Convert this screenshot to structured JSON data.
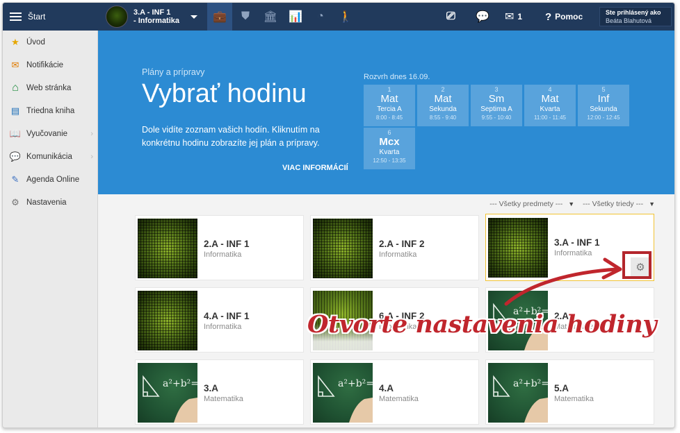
{
  "topbar": {
    "start_label": "Štart",
    "class_selector": {
      "line1": "3.A - INF 1",
      "line2": "- Informatika"
    },
    "module_tabs": [
      {
        "icon": "briefcase-icon",
        "glyph": "💼"
      },
      {
        "icon": "shield-icon",
        "glyph": "⛊"
      },
      {
        "icon": "school-building-icon",
        "glyph": "🏛"
      },
      {
        "icon": "bar-chart-icon",
        "glyph": "📊"
      },
      {
        "icon": "clock-icon",
        "glyph": "◔"
      },
      {
        "icon": "people-walking-icon",
        "glyph": "🚶"
      }
    ],
    "present_icon": "⎚",
    "chat_icon": "💬",
    "mail_icon": "✉",
    "mail_count": "1",
    "help_label": "Pomoc",
    "help_icon": "?",
    "login": {
      "line1": "Ste prihlásený ako",
      "line2": "Beáta Blahutová"
    }
  },
  "sidebar": {
    "items": [
      {
        "label": "Úvod",
        "icon": "star-icon",
        "glyph": "★",
        "color": "#e6a700",
        "chevron": false
      },
      {
        "label": "Notifikácie",
        "icon": "envelope-icon",
        "glyph": "✉",
        "color": "#e07b00",
        "chevron": false
      },
      {
        "label": "Web stránka",
        "icon": "home-icon",
        "glyph": "⌂",
        "color": "#1a8a3a",
        "chevron": false
      },
      {
        "label": "Triedna kniha",
        "icon": "book-icon",
        "glyph": "▤",
        "color": "#1e6fb8",
        "chevron": false
      },
      {
        "label": "Vyučovanie",
        "icon": "open-book-icon",
        "glyph": "📖",
        "color": "#2a6fa8",
        "chevron": true
      },
      {
        "label": "Komunikácia",
        "icon": "chat-icon",
        "glyph": "💬",
        "color": "#c0392b",
        "chevron": true
      },
      {
        "label": "Agenda Online",
        "icon": "pencil-icon",
        "glyph": "✎",
        "color": "#3a6fc0",
        "chevron": false
      },
      {
        "label": "Nastavenia",
        "icon": "gear-icon",
        "glyph": "⚙",
        "color": "#777777",
        "chevron": false
      }
    ]
  },
  "hero": {
    "kicker": "Plány a prípravy",
    "title": "Vybrať hodinu",
    "description": "Dole vidíte zoznam vašich hodín. Kliknutím na konkrétnu hodinu zobrazíte jej plán a prípravy.",
    "more_link": "VIAC INFORMÁCIÍ",
    "schedule_heading": "Rozvrh dnes 16.09.",
    "slots": [
      {
        "num": "1",
        "subject": "Mat",
        "class": "Tercia A",
        "time": "8:00 - 8:45"
      },
      {
        "num": "2",
        "subject": "Mat",
        "class": "Sekunda",
        "time": "8:55 - 9:40"
      },
      {
        "num": "3",
        "subject": "Sm",
        "class": "Septima A",
        "time": "9:55 - 10:40"
      },
      {
        "num": "4",
        "subject": "Mat",
        "class": "Kvarta",
        "time": "11:00 - 11:45"
      },
      {
        "num": "5",
        "subject": "Inf",
        "class": "Sekunda",
        "time": "12:00 - 12:45"
      },
      {
        "num": "6",
        "subject": "Mcx",
        "class": "Kvarta",
        "time": "12:50 - 13:35"
      }
    ]
  },
  "filters": {
    "subjects": "--- Všetky predmety ---",
    "classes": "--- Všetky triedy ---"
  },
  "cards": [
    {
      "name": "2.A - INF 1",
      "subject": "Informatika",
      "thumb": "digital"
    },
    {
      "name": "2.A - INF 2",
      "subject": "Informatika",
      "thumb": "digital"
    },
    {
      "name": "3.A - INF 1",
      "subject": "Informatika",
      "thumb": "digital"
    },
    {
      "name": "4.A - INF 1",
      "subject": "Informatika",
      "thumb": "digital"
    },
    {
      "name": "6.A - INF 2",
      "subject": "Informatika",
      "thumb": "mixed"
    },
    {
      "name": "2.A",
      "subject": "Matematika",
      "thumb": "board"
    },
    {
      "name": "3.A",
      "subject": "Matematika",
      "thumb": "board"
    },
    {
      "name": "4.A",
      "subject": "Matematika",
      "thumb": "board"
    },
    {
      "name": "5.A",
      "subject": "Matematika",
      "thumb": "board"
    }
  ],
  "card_gear_icon": "⚙",
  "annotation": {
    "text": "Otvorte nastavenia hodiny",
    "color": "#c0262d"
  }
}
